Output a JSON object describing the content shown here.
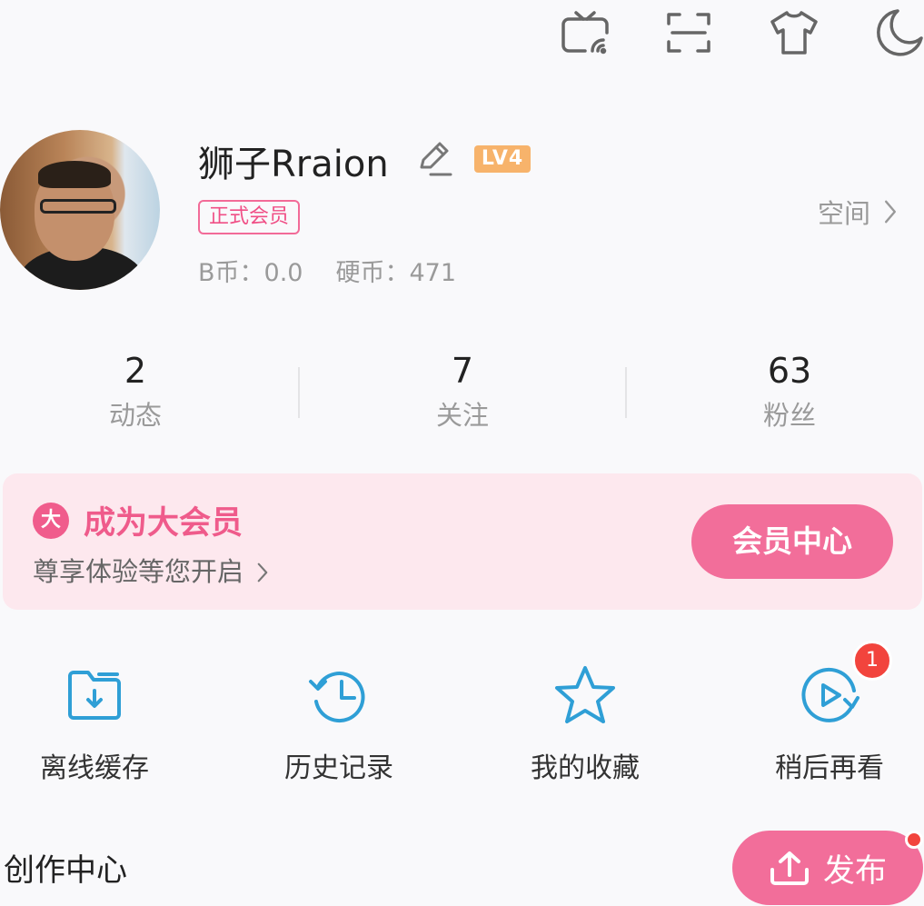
{
  "top_icons": [
    "tv-cast-icon",
    "scan-icon",
    "tshirt-icon",
    "moon-icon"
  ],
  "profile": {
    "name": "狮子Rraion",
    "level": "LV4",
    "member_tag": "正式会员",
    "b_coin": "B币：0.0",
    "coin": "硬币：471",
    "space_label": "空间"
  },
  "stats": [
    {
      "value": "2",
      "label": "动态"
    },
    {
      "value": "7",
      "label": "关注"
    },
    {
      "value": "63",
      "label": "粉丝"
    }
  ],
  "vip": {
    "badge": "大",
    "title": "成为大会员",
    "subtitle": "尊享体验等您开启",
    "button": "会员中心"
  },
  "tools": [
    {
      "label": "离线缓存",
      "icon": "download-folder-icon"
    },
    {
      "label": "历史记录",
      "icon": "history-clock-icon"
    },
    {
      "label": "我的收藏",
      "icon": "star-icon"
    },
    {
      "label": "稍后再看",
      "icon": "watch-later-icon",
      "badge": "1"
    }
  ],
  "creator": {
    "title": "创作中心",
    "publish_button": "发布"
  },
  "colors": {
    "accent_pink": "#f26e9a",
    "icon_blue": "#2f9fd6",
    "level_orange": "#f7b36b",
    "badge_red": "#f2443d"
  }
}
